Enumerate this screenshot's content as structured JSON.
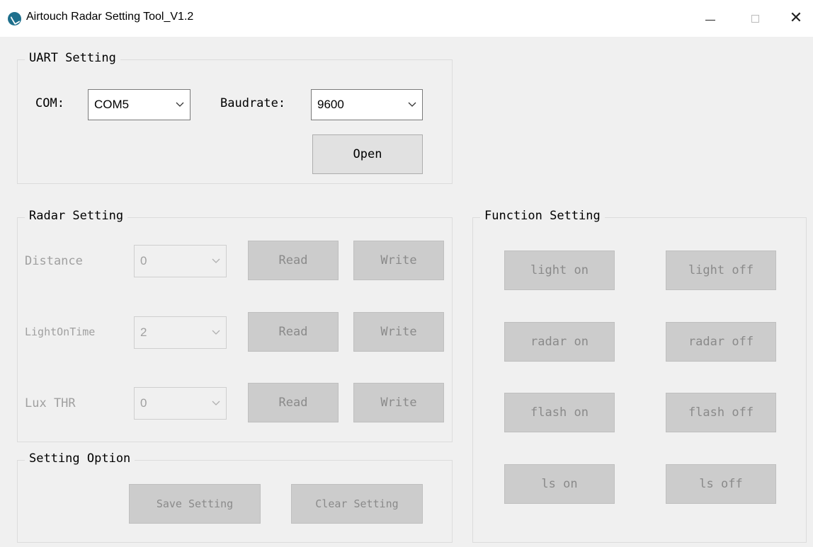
{
  "window": {
    "title": "Airtouch Radar Setting Tool_V1.2"
  },
  "uart": {
    "legend": "UART Setting",
    "com_label": "COM:",
    "com_value": "COM5",
    "baud_label": "Baudrate:",
    "baud_value": "9600",
    "open_label": "Open"
  },
  "radar": {
    "legend": "Radar Setting",
    "rows": [
      {
        "label": "Distance",
        "value": "0",
        "read": "Read",
        "write": "Write"
      },
      {
        "label": "LightOnTime",
        "value": "2",
        "read": "Read",
        "write": "Write"
      },
      {
        "label": "Lux THR",
        "value": "0",
        "read": "Read",
        "write": "Write"
      }
    ]
  },
  "options": {
    "legend": "Setting Option",
    "save_label": "Save Setting",
    "clear_label": "Clear Setting"
  },
  "function": {
    "legend": "Function Setting",
    "buttons": [
      {
        "on": "light on",
        "off": "light off"
      },
      {
        "on": "radar on",
        "off": "radar off"
      },
      {
        "on": "flash on",
        "off": "flash off"
      },
      {
        "on": "ls on",
        "off": "ls off"
      }
    ]
  },
  "icons": {
    "app": "radar-app-icon",
    "minimize": "minimize-icon",
    "maximize": "maximize-icon",
    "close": "close-icon",
    "dropdown": "chevron-down-icon"
  },
  "colors": {
    "app_icon": "#1e6f8c",
    "disabled_text": "#a0a0a0",
    "disabled_button": "#cccccc",
    "window_bg": "#f0f0f0"
  }
}
